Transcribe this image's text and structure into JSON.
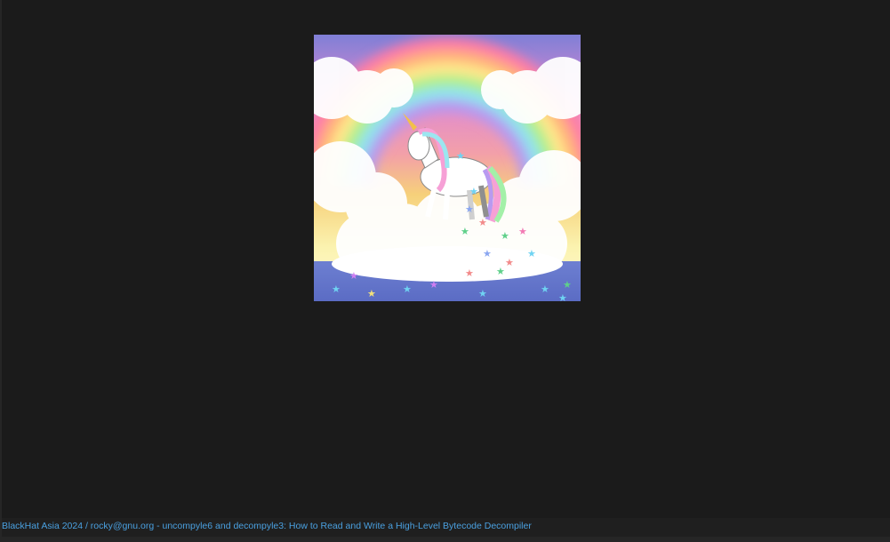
{
  "slide": {
    "image": {
      "description_icon": "unicode-rainbow-image"
    }
  },
  "footer": {
    "text": "BlackHat Asia 2024 / rocky@gnu.org - uncompyle6 and decompyle3: How to Read and Write a High-Level Bytecode Decompiler"
  },
  "colors": {
    "background": "#1b1b1b",
    "footer_text": "#4aa0e0"
  }
}
